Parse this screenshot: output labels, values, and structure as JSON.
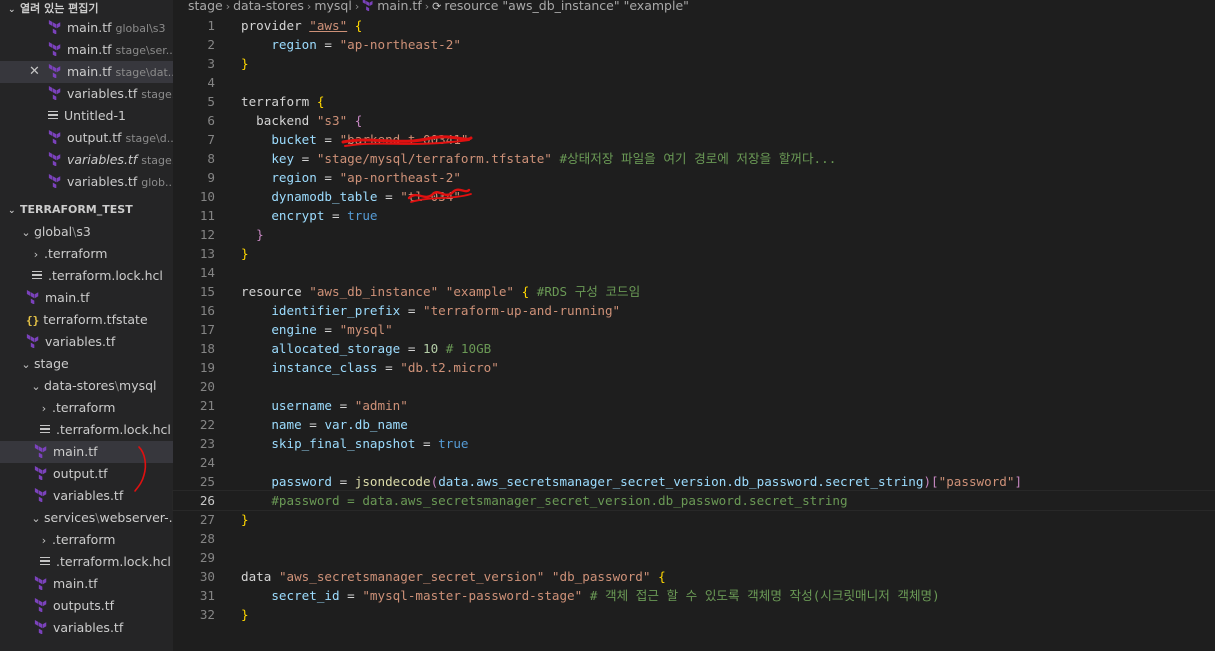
{
  "colors": {
    "sidebar_bg": "#252526",
    "editor_bg": "#1e1e1e",
    "terraform_icon": "#7b42bc",
    "string": "#ce9178",
    "comment": "#6a9955",
    "red_annotation": "#e01010"
  },
  "open_editors": {
    "title": "열려 있는 편집기",
    "items": [
      {
        "name": "main.tf",
        "hint": "global\\s3",
        "icon": "terraform-icon"
      },
      {
        "name": "main.tf",
        "hint": "stage\\ser...",
        "icon": "terraform-icon"
      },
      {
        "name": "main.tf",
        "hint": "stage\\dat...",
        "icon": "terraform-icon",
        "close": "✕"
      },
      {
        "name": "variables.tf",
        "hint": "stage...",
        "icon": "terraform-icon"
      },
      {
        "name": "Untitled-1",
        "hint": "",
        "icon": "lines-icon"
      },
      {
        "name": "output.tf",
        "hint": "stage\\d...",
        "icon": "terraform-icon"
      },
      {
        "name": "variables.tf",
        "hint": "stage...",
        "icon": "terraform-icon"
      },
      {
        "name": "variables.tf",
        "hint": "glob...",
        "icon": "terraform-icon"
      }
    ]
  },
  "explorer": {
    "title": "TERRAFORM_TEST",
    "tree": {
      "global": "global",
      "global_sep": "\\",
      "global_s3": "s3",
      "g_terraform": ".terraform",
      "g_lock": ".terraform.lock.hcl",
      "g_main": "main.tf",
      "g_tfstate": "terraform.tfstate",
      "g_variables": "variables.tf",
      "stage": "stage",
      "ds": "data-stores",
      "ds_sep": "\\",
      "ds_mysql": "mysql",
      "ds_terraform": ".terraform",
      "ds_lock": ".terraform.lock.hcl",
      "ds_main": "main.tf",
      "ds_output": "output.tf",
      "ds_variables": "variables.tf",
      "svc": "services",
      "svc_sep": "\\",
      "svc_web": "webserver-...",
      "svc_terraform": ".terraform",
      "svc_lock": ".terraform.lock.hcl",
      "svc_main": "main.tf",
      "svc_outputs": "outputs.tf",
      "svc_variables": "variables.tf"
    }
  },
  "breadcrumb": {
    "parts": [
      "stage",
      "data-stores",
      "mysql",
      "main.tf",
      "resource \"aws_db_instance\" \"example\""
    ]
  },
  "editor": {
    "active_line": 26,
    "line_numbers": [
      "1",
      "2",
      "3",
      "4",
      "5",
      "6",
      "7",
      "8",
      "9",
      "10",
      "11",
      "12",
      "13",
      "14",
      "15",
      "16",
      "17",
      "18",
      "19",
      "20",
      "21",
      "22",
      "23",
      "24",
      "25",
      "26",
      "27",
      "28",
      "29",
      "30",
      "31",
      "32"
    ]
  },
  "code": {
    "l1_kw": "provider",
    "l1_s": "\"aws\"",
    "l2_key": "region",
    "l2_s": "\"ap-northeast-2\"",
    "l5_kw": "terraform",
    "l6_kw": "backend",
    "l6_s": "\"s3\"",
    "l7_key": "bucket",
    "l7_s": "\"barkend-t-00341\"",
    "l8_key": "key",
    "l8_s": "\"stage/mysql/terraform.tfstate\"",
    "l8_c": "#상태저장 파일을 여기 경로에 저장을 할꺼다...",
    "l9_key": "region",
    "l9_s": "\"ap-northeast-2\"",
    "l10_key": "dynamodb_table",
    "l10_s": "\"tl-034\"",
    "l11_key": "encrypt",
    "l11_v": "true",
    "l15_kw": "resource",
    "l15_s1": "\"aws_db_instance\"",
    "l15_s2": "\"example\"",
    "l15_c": "#RDS 구성 코드임",
    "l16_key": "identifier_prefix",
    "l16_s": "\"terraform-up-and-running\"",
    "l17_key": "engine",
    "l17_s": "\"mysql\"",
    "l18_key": "allocated_storage",
    "l18_n": "10",
    "l18_c": "# 10GB",
    "l19_key": "instance_class",
    "l19_s": "\"db.t2.micro\"",
    "l21_key": "username",
    "l21_s": "\"admin\"",
    "l22_key": "name",
    "l22_v": "var.db_name",
    "l23_key": "skip_final_snapshot",
    "l23_v": "true",
    "l25_key": "password",
    "l25_f": "jsondecode",
    "l25_arg": "data.aws_secretsmanager_secret_version.db_password.secret_string",
    "l25_s": "\"password\"",
    "l26_c": "#password = data.aws_secretsmanager_secret_version.db_password.secret_string",
    "l30_kw": "data",
    "l30_s1": "\"aws_secretsmanager_secret_version\"",
    "l30_s2": "\"db_password\"",
    "l31_key": "secret_id",
    "l31_s": "\"mysql-master-password-stage\"",
    "l31_c": "# 객체 접근 할 수 있도록 객체명 작성(시크릿매니저 객체명)"
  }
}
